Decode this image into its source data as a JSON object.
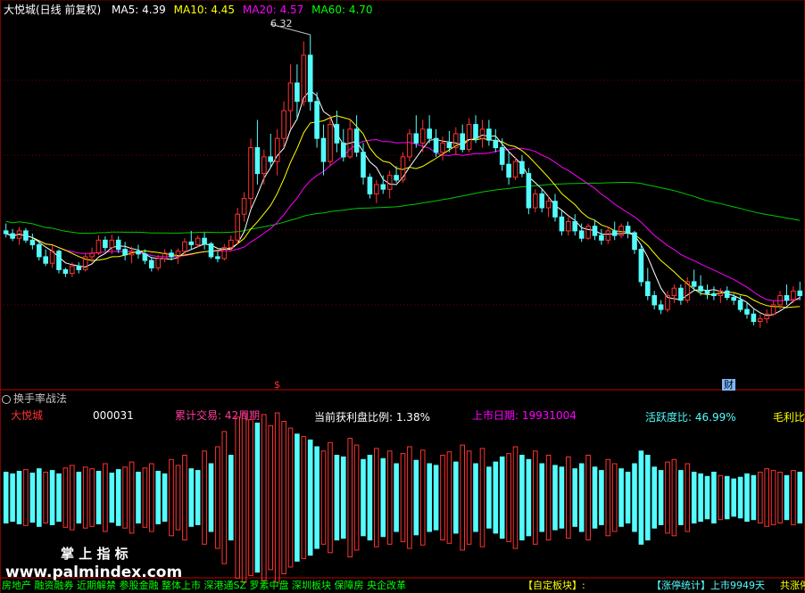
{
  "header": {
    "title": "大悦城(日线 前复权)",
    "ma": [
      {
        "label": "MA5:",
        "value": "4.39",
        "color": "#ffffff"
      },
      {
        "label": "MA10:",
        "value": "4.45",
        "color": "#ffff00"
      },
      {
        "label": "MA20:",
        "value": "4.57",
        "color": "#ff00ff"
      },
      {
        "label": "MA60:",
        "value": "4.70",
        "color": "#00ff00"
      }
    ]
  },
  "price_panel": {
    "high_label": "6.32",
    "marker_s": "$",
    "marker_cai": "财"
  },
  "indicator": {
    "title": "换手率战法",
    "stock_name": "大悦城",
    "stock_code": "000031",
    "cumulative": "累计交易: 42周期",
    "profit_ratio": "当前获利盘比例: 1.38%",
    "listing_date": "上市日期: 19931004",
    "activity": "活跃度比: 46.99%",
    "gross_margin": "毛利比"
  },
  "watermark": {
    "brand": "掌 上 指 标",
    "url": "www.palmindex.com"
  },
  "footer": {
    "tags": "房地产 融资融券 近期解禁 参股金融 整体上市 深港通SZ 罗素中盘 深圳板块 保障房 央企改革",
    "custom_block": "【自定板块】:",
    "limit_stats": "【涨停统计】",
    "listed_days": "上市9949天",
    "total_prefix": "共涨停"
  },
  "colors": {
    "up": "#ff3232",
    "down": "#54fcfc",
    "ma5": "#ffffff",
    "ma10": "#ffff00",
    "ma20": "#ff00ff",
    "ma60": "#00c800",
    "grid": "#800000"
  },
  "chart_data": {
    "type": "candlestick",
    "price_range": [
      2.55,
      6.6
    ],
    "candles": [
      [
        4.2,
        4.28,
        4.13,
        4.17
      ],
      [
        4.17,
        4.22,
        4.09,
        4.12
      ],
      [
        4.12,
        4.24,
        4.05,
        4.2
      ],
      [
        4.2,
        4.23,
        4.07,
        4.1
      ],
      [
        4.1,
        4.17,
        4.0,
        4.05
      ],
      [
        4.05,
        4.1,
        3.88,
        3.92
      ],
      [
        3.92,
        4.0,
        3.82,
        3.85
      ],
      [
        3.85,
        4.04,
        3.8,
        3.98
      ],
      [
        3.98,
        4.0,
        3.74,
        3.78
      ],
      [
        3.78,
        3.8,
        3.7,
        3.74
      ],
      [
        3.74,
        3.86,
        3.7,
        3.82
      ],
      [
        3.82,
        3.86,
        3.74,
        3.78
      ],
      [
        3.78,
        3.96,
        3.76,
        3.92
      ],
      [
        3.92,
        4.02,
        3.86,
        3.96
      ],
      [
        3.96,
        4.15,
        3.94,
        4.1
      ],
      [
        4.1,
        4.14,
        3.98,
        4.02
      ],
      [
        4.02,
        4.16,
        3.95,
        4.1
      ],
      [
        4.1,
        4.14,
        3.96,
        4.0
      ],
      [
        4.0,
        4.08,
        3.88,
        3.94
      ],
      [
        3.94,
        4.03,
        3.85,
        3.98
      ],
      [
        3.98,
        4.05,
        3.9,
        3.95
      ],
      [
        3.95,
        4.0,
        3.84,
        3.88
      ],
      [
        3.88,
        3.92,
        3.76,
        3.8
      ],
      [
        3.8,
        3.94,
        3.77,
        3.9
      ],
      [
        3.9,
        4.0,
        3.86,
        3.96
      ],
      [
        3.96,
        4.0,
        3.88,
        3.92
      ],
      [
        3.92,
        4.01,
        3.84,
        3.98
      ],
      [
        3.98,
        4.12,
        3.95,
        4.08
      ],
      [
        4.08,
        4.2,
        4.0,
        4.05
      ],
      [
        4.05,
        4.15,
        4.02,
        4.12
      ],
      [
        4.12,
        4.18,
        4.0,
        4.06
      ],
      [
        4.06,
        4.08,
        3.9,
        3.92
      ],
      [
        3.92,
        3.98,
        3.86,
        3.9
      ],
      [
        3.9,
        4.06,
        3.88,
        4.02
      ],
      [
        4.02,
        4.15,
        3.98,
        4.1
      ],
      [
        4.1,
        4.45,
        4.05,
        4.38
      ],
      [
        4.38,
        4.62,
        4.3,
        4.55
      ],
      [
        4.55,
        5.2,
        4.45,
        5.1
      ],
      [
        5.1,
        5.4,
        4.7,
        4.82
      ],
      [
        4.82,
        5.08,
        4.7,
        5.0
      ],
      [
        5.0,
        5.25,
        4.88,
        4.95
      ],
      [
        4.95,
        5.3,
        4.8,
        5.2
      ],
      [
        5.2,
        5.6,
        5.1,
        5.5
      ],
      [
        5.5,
        6.0,
        5.3,
        5.8
      ],
      [
        5.8,
        6.0,
        5.4,
        5.6
      ],
      [
        5.6,
        6.25,
        5.55,
        6.1
      ],
      [
        6.1,
        6.32,
        5.5,
        5.6
      ],
      [
        5.6,
        5.7,
        5.1,
        5.2
      ],
      [
        5.2,
        5.35,
        4.8,
        4.95
      ],
      [
        4.95,
        5.45,
        4.9,
        5.35
      ],
      [
        5.35,
        5.5,
        5.05,
        5.15
      ],
      [
        5.15,
        5.3,
        4.95,
        5.0
      ],
      [
        5.0,
        5.4,
        4.98,
        5.3
      ],
      [
        5.3,
        5.45,
        5.0,
        5.05
      ],
      [
        5.05,
        5.15,
        4.7,
        4.78
      ],
      [
        4.78,
        4.82,
        4.55,
        4.6
      ],
      [
        4.6,
        4.75,
        4.5,
        4.7
      ],
      [
        4.7,
        4.8,
        4.6,
        4.65
      ],
      [
        4.65,
        4.85,
        4.55,
        4.8
      ],
      [
        4.8,
        4.9,
        4.72,
        4.75
      ],
      [
        4.75,
        5.05,
        4.72,
        5.0
      ],
      [
        5.0,
        5.3,
        4.95,
        5.25
      ],
      [
        5.25,
        5.45,
        5.1,
        5.15
      ],
      [
        5.15,
        5.4,
        5.05,
        5.3
      ],
      [
        5.3,
        5.45,
        5.15,
        5.2
      ],
      [
        5.2,
        5.3,
        5.0,
        5.05
      ],
      [
        5.05,
        5.22,
        4.96,
        5.15
      ],
      [
        5.15,
        5.28,
        5.05,
        5.1
      ],
      [
        5.1,
        5.32,
        5.02,
        5.25
      ],
      [
        5.25,
        5.35,
        5.05,
        5.08
      ],
      [
        5.08,
        5.42,
        5.05,
        5.35
      ],
      [
        5.35,
        5.45,
        5.15,
        5.2
      ],
      [
        5.2,
        5.4,
        5.1,
        5.3
      ],
      [
        5.3,
        5.4,
        5.12,
        5.18
      ],
      [
        5.18,
        5.3,
        5.05,
        5.1
      ],
      [
        5.1,
        5.2,
        4.85,
        4.92
      ],
      [
        4.92,
        5.05,
        4.7,
        4.78
      ],
      [
        4.78,
        5.0,
        4.75,
        4.95
      ],
      [
        4.95,
        5.02,
        4.78,
        4.82
      ],
      [
        4.82,
        4.88,
        4.38,
        4.45
      ],
      [
        4.45,
        4.65,
        4.4,
        4.6
      ],
      [
        4.6,
        4.65,
        4.4,
        4.45
      ],
      [
        4.45,
        4.58,
        4.35,
        4.52
      ],
      [
        4.52,
        4.6,
        4.3,
        4.35
      ],
      [
        4.35,
        4.42,
        4.15,
        4.2
      ],
      [
        4.2,
        4.35,
        4.15,
        4.3
      ],
      [
        4.3,
        4.38,
        4.15,
        4.2
      ],
      [
        4.2,
        4.28,
        4.08,
        4.12
      ],
      [
        4.12,
        4.28,
        4.1,
        4.25
      ],
      [
        4.25,
        4.32,
        4.1,
        4.15
      ],
      [
        4.15,
        4.22,
        4.05,
        4.1
      ],
      [
        4.1,
        4.25,
        4.06,
        4.2
      ],
      [
        4.2,
        4.3,
        4.1,
        4.15
      ],
      [
        4.15,
        4.28,
        4.12,
        4.25
      ],
      [
        4.25,
        4.3,
        4.12,
        4.18
      ],
      [
        4.18,
        4.2,
        3.95,
        4.0
      ],
      [
        4.0,
        4.05,
        3.6,
        3.65
      ],
      [
        3.65,
        3.8,
        3.45,
        3.5
      ],
      [
        3.5,
        3.55,
        3.35,
        3.4
      ],
      [
        3.4,
        3.45,
        3.3,
        3.35
      ],
      [
        3.35,
        3.55,
        3.32,
        3.5
      ],
      [
        3.5,
        3.62,
        3.42,
        3.58
      ],
      [
        3.58,
        3.62,
        3.4,
        3.45
      ],
      [
        3.45,
        3.7,
        3.42,
        3.65
      ],
      [
        3.65,
        3.78,
        3.55,
        3.6
      ],
      [
        3.6,
        3.72,
        3.5,
        3.55
      ],
      [
        3.55,
        3.62,
        3.46,
        3.52
      ],
      [
        3.52,
        3.6,
        3.45,
        3.5
      ],
      [
        3.5,
        3.58,
        3.42,
        3.55
      ],
      [
        3.55,
        3.6,
        3.45,
        3.48
      ],
      [
        3.48,
        3.52,
        3.4,
        3.45
      ],
      [
        3.45,
        3.5,
        3.32,
        3.35
      ],
      [
        3.35,
        3.42,
        3.25,
        3.3
      ],
      [
        3.3,
        3.35,
        3.18,
        3.22
      ],
      [
        3.22,
        3.3,
        3.15,
        3.25
      ],
      [
        3.25,
        3.35,
        3.2,
        3.3
      ],
      [
        3.3,
        3.45,
        3.28,
        3.4
      ],
      [
        3.4,
        3.55,
        3.35,
        3.5
      ],
      [
        3.5,
        3.62,
        3.4,
        3.45
      ],
      [
        3.45,
        3.6,
        3.42,
        3.55
      ],
      [
        3.55,
        3.65,
        3.45,
        3.5
      ]
    ],
    "turnover": {
      "up": [
        0,
        0,
        0,
        1,
        0,
        0,
        1,
        0,
        0,
        1,
        1,
        0,
        1,
        1,
        0,
        1,
        0,
        0,
        1,
        1,
        0,
        1,
        1,
        0,
        0,
        1,
        1,
        1,
        0,
        0,
        1,
        0,
        1,
        1,
        0,
        1,
        1,
        1,
        0,
        1,
        1,
        1,
        1,
        1,
        0,
        1,
        0,
        0,
        1,
        1,
        0,
        0,
        1,
        1,
        0,
        0,
        1,
        0,
        1,
        0,
        1,
        1,
        0,
        1,
        0,
        0,
        1,
        1,
        0,
        1,
        1,
        0,
        1,
        0,
        0,
        0,
        1,
        1,
        0,
        0,
        1,
        0,
        1,
        0,
        0,
        1,
        0,
        0,
        1,
        0,
        0,
        1,
        1,
        0,
        0,
        0,
        0,
        0,
        0,
        0,
        1,
        1,
        0,
        1,
        0,
        0,
        0,
        0,
        1,
        0,
        0,
        0,
        0,
        0,
        1,
        1,
        1,
        1,
        0,
        1,
        0
      ],
      "size": [
        0.3,
        0.28,
        0.31,
        0.33,
        0.29,
        0.34,
        0.3,
        0.32,
        0.28,
        0.35,
        0.38,
        0.3,
        0.36,
        0.34,
        0.31,
        0.4,
        0.29,
        0.33,
        0.36,
        0.42,
        0.3,
        0.35,
        0.4,
        0.31,
        0.28,
        0.45,
        0.38,
        0.5,
        0.34,
        0.32,
        0.55,
        0.4,
        0.6,
        0.78,
        0.5,
        0.95,
        1.0,
        0.92,
        0.88,
        0.98,
        0.85,
        1.0,
        0.9,
        0.82,
        0.75,
        0.72,
        0.68,
        0.6,
        0.55,
        0.65,
        0.5,
        0.48,
        0.7,
        0.62,
        0.45,
        0.5,
        0.58,
        0.46,
        0.55,
        0.4,
        0.52,
        0.6,
        0.44,
        0.56,
        0.4,
        0.38,
        0.5,
        0.54,
        0.42,
        0.62,
        0.55,
        0.4,
        0.58,
        0.36,
        0.42,
        0.48,
        0.52,
        0.6,
        0.5,
        0.45,
        0.55,
        0.4,
        0.5,
        0.38,
        0.36,
        0.48,
        0.34,
        0.4,
        0.5,
        0.36,
        0.32,
        0.45,
        0.4,
        0.34,
        0.3,
        0.4,
        0.55,
        0.5,
        0.36,
        0.32,
        0.42,
        0.45,
        0.32,
        0.4,
        0.3,
        0.28,
        0.25,
        0.3,
        0.26,
        0.25,
        0.22,
        0.24,
        0.28,
        0.26,
        0.3,
        0.34,
        0.32,
        0.3,
        0.26,
        0.32,
        0.3
      ]
    }
  }
}
